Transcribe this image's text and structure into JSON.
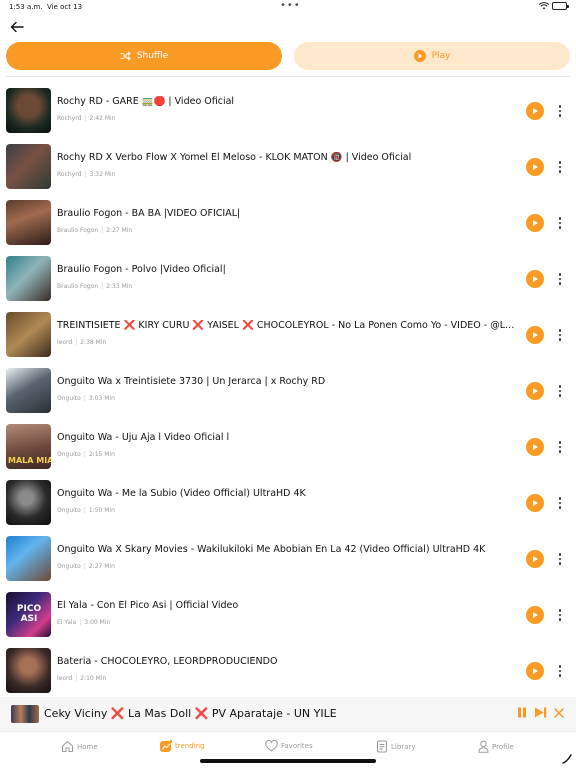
{
  "status_bar": {
    "time": "1:53 a.m.",
    "date": "Vie oct 13"
  },
  "actions": {
    "shuffle_label": "Shuffle",
    "play_label": "Play"
  },
  "tracks": [
    {
      "title": "Rochy RD - GARE 🚃🛑 | Video Oficial",
      "artist": "Rochyrd",
      "duration": "2:42 Min"
    },
    {
      "title": "Rochy RD X Verbo Flow X Yomel El Meloso - KLOK MATON 🔞 | Video Oficial",
      "artist": "Rochyrd",
      "duration": "3:32 Min"
    },
    {
      "title": "Braulio Fogon - BA BA |VIDEO OFICIAL|",
      "artist": "Braulio Fogon",
      "duration": "2:27 Min"
    },
    {
      "title": "Braulio Fogon - Polvo |Video Oficial|",
      "artist": "Braulio Fogon",
      "duration": "2:33 Min"
    },
    {
      "title": "TREINTISIETE ❌ KIRY CURU ❌ YAISEL ❌ CHOCOLEYROL - No La Ponen Como Yo - VIDEO - @Leor...",
      "artist": "leord",
      "duration": "2:38 Min"
    },
    {
      "title": "Onguito Wa x Treintisiete 3730 | Un Jerarca | x Rochy RD",
      "artist": "Onguito",
      "duration": "3:03 Min"
    },
    {
      "title": "Onguito Wa - Uju Aja l Video Oficial l",
      "artist": "Onguito",
      "duration": "2:15 Min"
    },
    {
      "title": "Onguito Wa - Me la Subio (Video Official) UltraHD 4K",
      "artist": "Onguito",
      "duration": "1:50 Min"
    },
    {
      "title": "Onguito Wa X Skary Movies - Wakilukiloki Me Abobian En La 42 (Video Official) UltraHD 4K",
      "artist": "Onguito",
      "duration": "2:27 Min"
    },
    {
      "title": "El Yala - Con El Pico Asi | Official Video",
      "artist": "El Yala",
      "duration": "3:00 Min"
    },
    {
      "title": "Bateria - CHOCOLEYRO, LEORDPRODUCIENDO",
      "artist": "leord",
      "duration": "2:10 Min"
    }
  ],
  "thumb_text": {
    "t7": "MALA MIA",
    "t10": "PICO ASI"
  },
  "now_playing": {
    "title": "Ceky Viciny ❌ La Mas Doll ❌ PV Aparataje - UN YILE"
  },
  "tabs": [
    {
      "key": "home",
      "label": "Home",
      "icon": "home-icon"
    },
    {
      "key": "trending",
      "label": "trending",
      "icon": "trending-icon"
    },
    {
      "key": "favorites",
      "label": "Favorites",
      "icon": "heart-icon"
    },
    {
      "key": "library",
      "label": "Library",
      "icon": "library-icon"
    },
    {
      "key": "profile",
      "label": "Profile",
      "icon": "profile-icon"
    }
  ],
  "active_tab": "trending",
  "colors": {
    "accent": "#f99a25",
    "accent_soft": "#fde8cc",
    "text": "#111111",
    "muted": "#9a9a9a"
  }
}
